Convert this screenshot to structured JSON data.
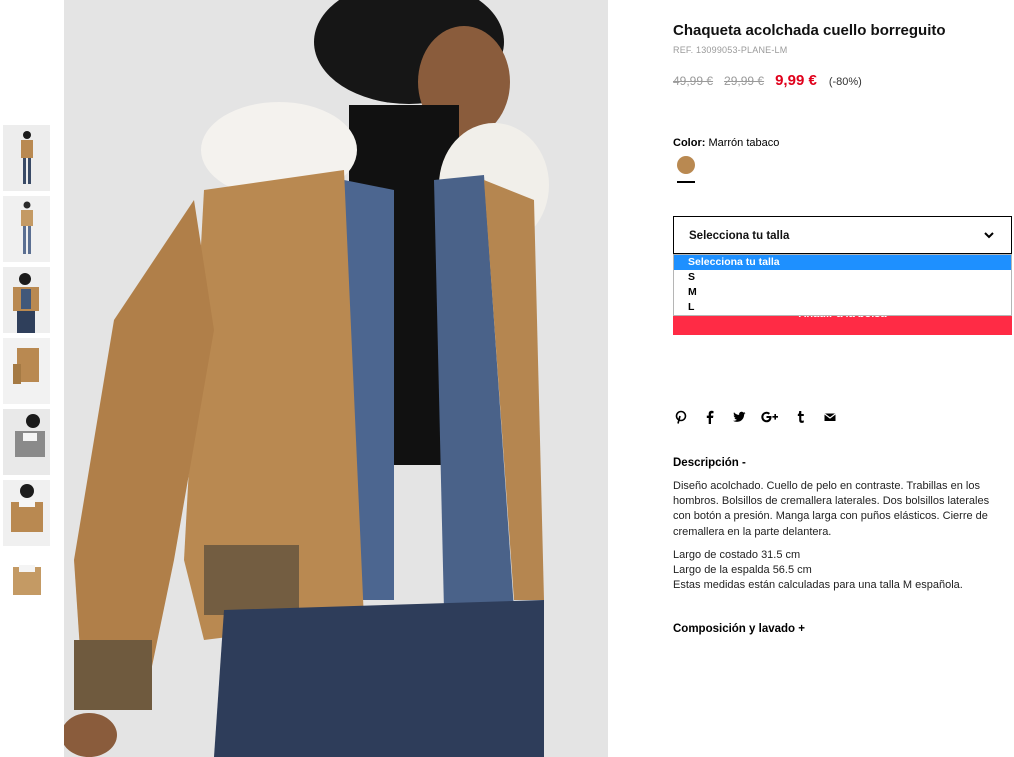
{
  "product": {
    "title": "Chaqueta acolchada cuello borreguito",
    "ref": "REF. 13099053-PLANE-LM",
    "prices": {
      "original": "49,99 €",
      "previous": "29,99 €",
      "current": "9,99 €",
      "discount": "(-80%)"
    },
    "color": {
      "label": "Color:",
      "value": "Marrón tabaco",
      "swatch_hex": "#b98951"
    }
  },
  "size_select": {
    "label": "Selecciona tu talla",
    "options": [
      "Selecciona tu talla",
      "S",
      "M",
      "L"
    ],
    "selected_index": 0
  },
  "cart": {
    "button_label": "Añadir a la bolsa"
  },
  "share": {
    "icons": [
      "pinterest-icon",
      "facebook-icon",
      "twitter-icon",
      "google-plus-icon",
      "tumblr-icon",
      "email-icon"
    ]
  },
  "description": {
    "title": "Descripción -",
    "text": "Diseño acolchado. Cuello de pelo en contraste. Trabillas en los hombros. Bolsillos de cremallera laterales. Dos bolsillos laterales con botón a presión. Manga larga con puños elásticos. Cierre de cremallera en la parte delantera.",
    "measures": [
      "Largo de costado 31.5 cm",
      "Largo de la espalda 56.5 cm",
      "Estas medidas están calculadas para una talla M española."
    ]
  },
  "composition": {
    "title": "Composición y lavado +"
  },
  "colors": {
    "sale_red": "#e0001b",
    "button_red": "#ff2b45",
    "selected_blue": "#1e90ff",
    "jacket_tan": "#b98951",
    "denim": "#41587a"
  }
}
